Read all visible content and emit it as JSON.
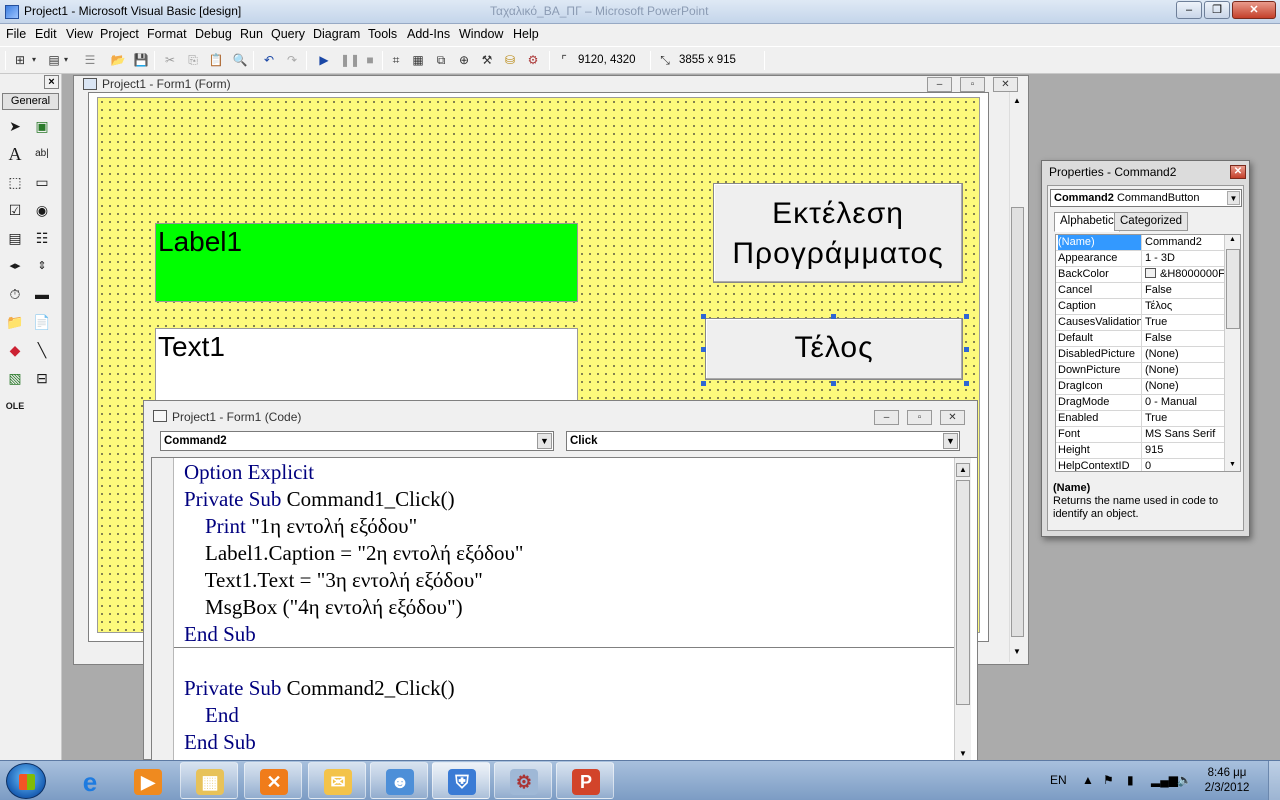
{
  "window": {
    "title": "Project1 - Microsoft Visual Basic [design]",
    "background_title": "Ταχαλικό_ΒΑ_ΠΓ – Microsoft PowerPoint"
  },
  "menu": [
    "File",
    "Edit",
    "View",
    "Project",
    "Format",
    "Debug",
    "Run",
    "Query",
    "Diagram",
    "Tools",
    "Add-Ins",
    "Window",
    "Help"
  ],
  "toolbar": {
    "position": "9120, 4320",
    "size": "3855 x 915"
  },
  "toolbox": {
    "tab_label": "General",
    "close": "×"
  },
  "form_window": {
    "title": "Project1 - Form1 (Form)",
    "label1": "Label1",
    "text1": "Text1",
    "command1": "Εκτέλεση Προγράμματος",
    "command2": "Τέλος"
  },
  "code_window": {
    "title": "Project1 - Form1 (Code)",
    "object_combo": "Command2",
    "procedure_combo": "Click",
    "lines": [
      {
        "kw": "Option Explicit",
        "rest": ""
      },
      {
        "kw": "Private Sub",
        "rest": " Command1_Click()"
      },
      {
        "kw": "    Print",
        "rest": " \"1η εντολή εξόδου\""
      },
      {
        "kw": "",
        "rest": "    Label1.Caption = \"2η εντολή εξόδου\""
      },
      {
        "kw": "",
        "rest": "    Text1.Text = \"3η εντολή εξόδου\""
      },
      {
        "kw": "",
        "rest": "    MsgBox (\"4η εντολή εξόδου\")"
      },
      {
        "kw": "End Sub",
        "rest": ""
      },
      {
        "kw": "",
        "rest": ""
      },
      {
        "kw": "Private Sub",
        "rest": " Command2_Click()"
      },
      {
        "kw": "    End",
        "rest": ""
      },
      {
        "kw": "End Sub",
        "rest": ""
      }
    ]
  },
  "properties": {
    "title": "Properties - Command2",
    "object_name": "Command2",
    "object_type": "CommandButton",
    "tabs": [
      "Alphabetic",
      "Categorized"
    ],
    "rows": [
      {
        "name": "(Name)",
        "value": "Command2"
      },
      {
        "name": "Appearance",
        "value": "1 - 3D"
      },
      {
        "name": "BackColor",
        "value": "&H8000000F"
      },
      {
        "name": "Cancel",
        "value": "False"
      },
      {
        "name": "Caption",
        "value": "Τέλος"
      },
      {
        "name": "CausesValidation",
        "value": "True"
      },
      {
        "name": "Default",
        "value": "False"
      },
      {
        "name": "DisabledPicture",
        "value": "(None)"
      },
      {
        "name": "DownPicture",
        "value": "(None)"
      },
      {
        "name": "DragIcon",
        "value": "(None)"
      },
      {
        "name": "DragMode",
        "value": "0 - Manual"
      },
      {
        "name": "Enabled",
        "value": "True"
      },
      {
        "name": "Font",
        "value": "MS Sans Serif"
      },
      {
        "name": "Height",
        "value": "915"
      },
      {
        "name": "HelpContextID",
        "value": "0"
      }
    ],
    "description_title": "(Name)",
    "description_text": "Returns the name used in code to identify an object."
  },
  "taskbar": {
    "language": "EN",
    "time": "8:46 μμ",
    "date": "2/3/2012"
  }
}
